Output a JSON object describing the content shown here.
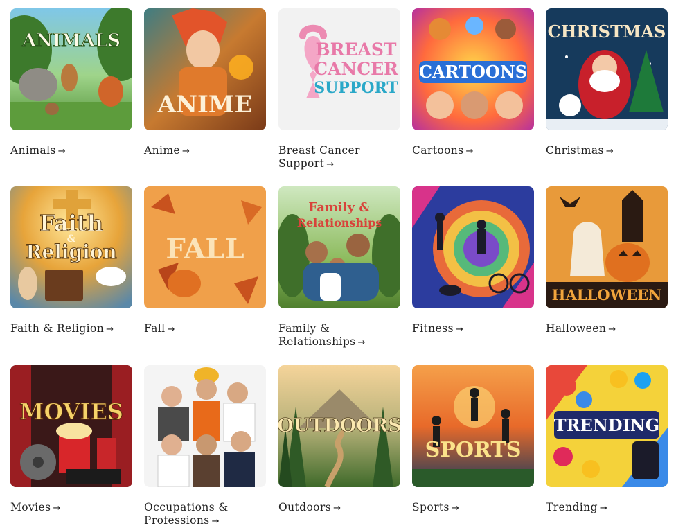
{
  "categories": [
    {
      "label": "Animals",
      "image_text": "ANIMALS",
      "arrow": "→"
    },
    {
      "label": "Anime",
      "image_text": "ANIME",
      "arrow": "→"
    },
    {
      "label": "Breast Cancer Support",
      "image_text": [
        "BREAST",
        "CANCER",
        "SUPPORT"
      ],
      "arrow": "→"
    },
    {
      "label": "Cartoons",
      "image_text": "CARTOONS",
      "arrow": "→"
    },
    {
      "label": "Christmas",
      "image_text": "CHRISTMAS",
      "arrow": "→"
    },
    {
      "label": "Faith & Religion",
      "image_text": [
        "Faith",
        "&",
        "Religion"
      ],
      "arrow": "→"
    },
    {
      "label": "Fall",
      "image_text": "FALL",
      "arrow": "→"
    },
    {
      "label": "Family & Relationships",
      "image_text": [
        "Family &",
        "Relationships"
      ],
      "arrow": "→"
    },
    {
      "label": "Fitness",
      "image_text": "",
      "arrow": "→"
    },
    {
      "label": "Halloween",
      "image_text": "HALLOWEEN",
      "arrow": "→"
    },
    {
      "label": "Movies",
      "image_text": "MOVIES",
      "arrow": "→"
    },
    {
      "label": "Occupations & Professions",
      "image_text": "",
      "arrow": "→"
    },
    {
      "label": "Outdoors",
      "image_text": "OUTDOORS",
      "arrow": "→"
    },
    {
      "label": "Sports",
      "image_text": "SPORTS",
      "arrow": "→"
    },
    {
      "label": "Trending",
      "image_text": "TRENDING",
      "arrow": "→"
    }
  ],
  "colors": {
    "text": "#222222",
    "background": "#ffffff",
    "ribbon": "#f4a6c6",
    "breast_cancer_blue": "#2aa8c8"
  }
}
